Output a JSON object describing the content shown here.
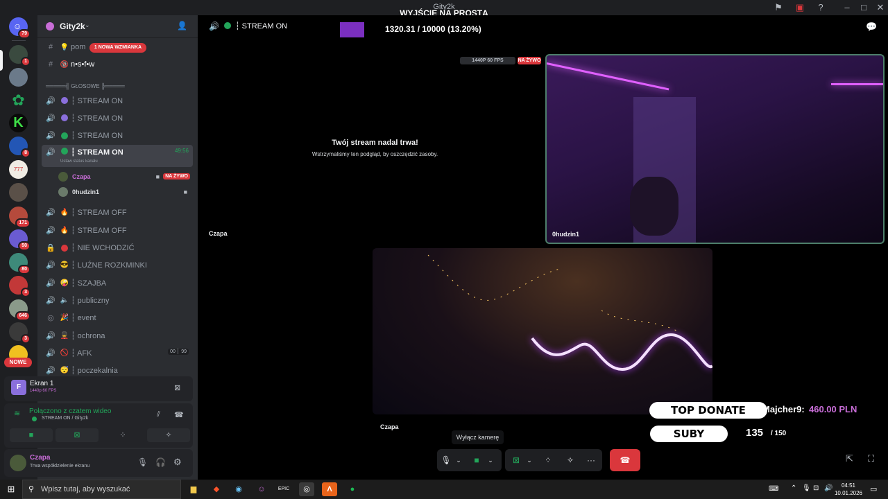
{
  "window": {
    "title": "Gity2k",
    "overlay_goal_title": "WYJŚCIE NA PROSTĄ",
    "overlay_goal_value": "1320.31 / 10000 (13.20%)"
  },
  "server": {
    "name": "Gity2k"
  },
  "mention_badge": "1 NOWA WZMIANKA",
  "text_channels": [
    {
      "name": "pom",
      "emoji": "💡"
    },
    {
      "name": "n•s•f•w",
      "emoji": "🔞"
    }
  ],
  "voice_category": "═════╣ GŁOSOWE ╠═════",
  "voice_channels": [
    {
      "name": "┆ STREAM ON",
      "dot": "#8a6fdc"
    },
    {
      "name": "┆ STREAM ON",
      "dot": "#8a6fdc"
    },
    {
      "name": "┆ STREAM ON",
      "dot": "#23a55a"
    },
    {
      "name": "┆ STREAM ON",
      "dot": "#23a55a",
      "timer": "49:56",
      "status": "Ustaw status kanału",
      "active": true
    },
    {
      "name": "┆ STREAM OFF",
      "emoji": "🔥"
    },
    {
      "name": "┆ STREAM OFF",
      "emoji": "🔥"
    },
    {
      "name": "┆ NIE WCHODZIĆ",
      "dot": "#da373c",
      "locked": true
    },
    {
      "name": "┆ LUŹNE ROZKMINKI",
      "emoji": "😎"
    },
    {
      "name": "┆ SZAJBA",
      "emoji": "🤪"
    },
    {
      "name": "┆ publiczny",
      "emoji": "🔈"
    },
    {
      "name": "┆ event",
      "emoji": "🎉"
    },
    {
      "name": "┆ ochrona",
      "emoji": "💂"
    },
    {
      "name": "┆ AFK",
      "emoji": "🚫",
      "counter": "00 │ 99"
    },
    {
      "name": "┆ poczekalnia",
      "emoji": "😴"
    }
  ],
  "voice_users": [
    {
      "name": "Czapa",
      "live": "NA ŻYWO"
    },
    {
      "name": "0hudzin1"
    }
  ],
  "rail_badges": [
    "79",
    "1",
    "8",
    "171",
    "50",
    "80",
    "3",
    "646",
    "3"
  ],
  "rail_new_label": "NOWE",
  "screen_share": {
    "title": "Ekran 1",
    "quality": "1440p 60 FPS"
  },
  "voice_status": {
    "title": "Połączono z czatem wideo",
    "channel": "STREAM ON / Gity2k"
  },
  "current_user": {
    "name": "Czapa",
    "status": "Trwa współdzielenie ekranu"
  },
  "main": {
    "channel_name": "┆ STREAM ON",
    "paused_title": "Twój stream nadal trwa!",
    "paused_sub": "Wstrzymaliśmy ten podgląd, by oszczędzić zasoby.",
    "stream_quality": "1440P 60 FPS",
    "live_label": "NA ŻYWO",
    "tile1_user": "Czapa",
    "tile2_user": "0hudzin1",
    "tile3_user": "Czapa",
    "tooltip": "Wyłącz kamerę"
  },
  "donate": {
    "label": "TOP DONATE",
    "donor": "Majcher9:",
    "amount": "460.00 PLN"
  },
  "subs": {
    "label": "SUBY",
    "current": "135",
    "goal": "/ 150"
  },
  "taskbar": {
    "search_placeholder": "Wpisz tutaj, aby wyszukać",
    "time": "04:51",
    "date": "10.01.2026"
  }
}
